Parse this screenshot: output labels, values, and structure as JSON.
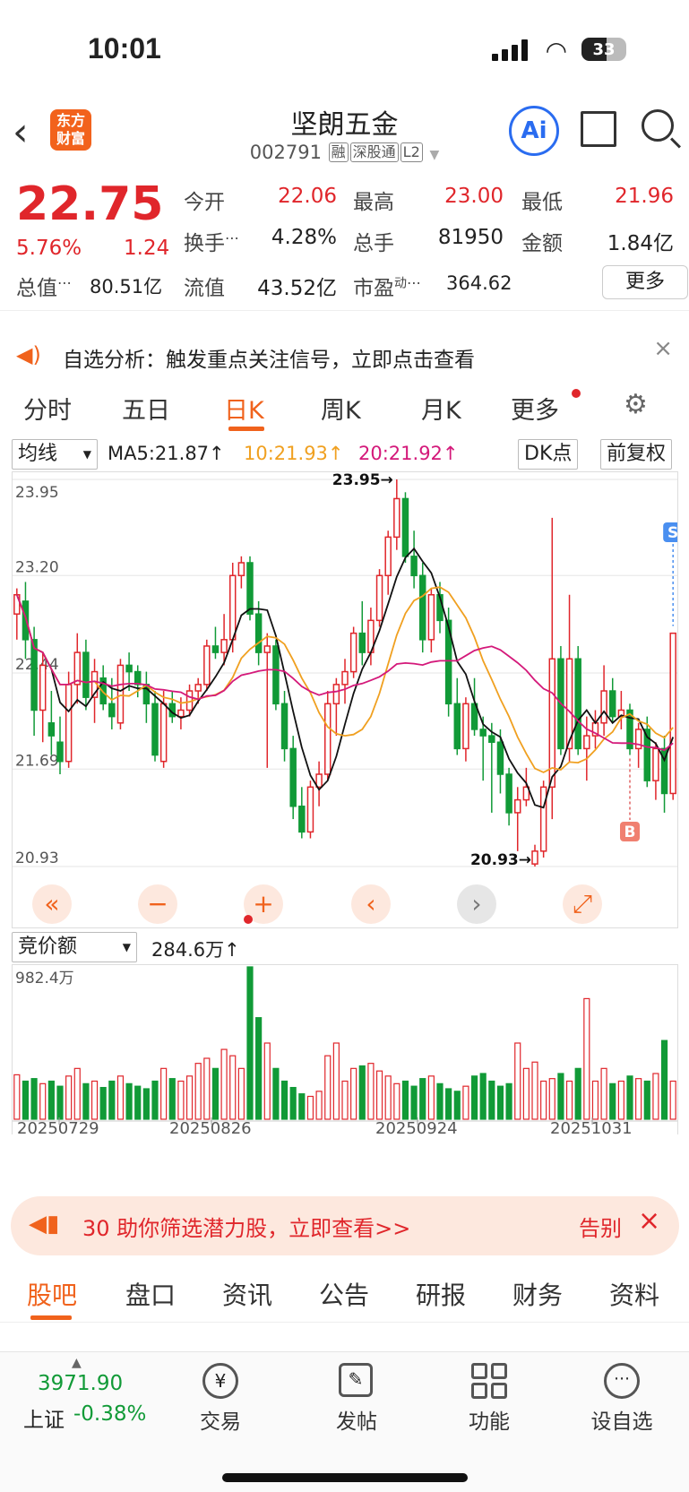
{
  "status": {
    "time": "10:01",
    "battery": "33"
  },
  "header": {
    "title": "坚朗五金",
    "code": "002791",
    "tags": [
      "融",
      "深股通",
      "L2"
    ],
    "logo_line1": "东方",
    "logo_line2": "财富",
    "ai_label": "Ai"
  },
  "quote": {
    "price": "22.75",
    "pct": "5.76%",
    "change": "1.24",
    "open_label": "今开",
    "open": "22.06",
    "high_label": "最高",
    "high": "23.00",
    "low_label": "最低",
    "low": "21.96",
    "turnover_label": "换手",
    "turnover": "4.28%",
    "volume_label": "总手",
    "volume": "81950",
    "amount_label": "金额",
    "amount": "1.84亿",
    "mcap_label": "总值",
    "mcap": "80.51亿",
    "float_label": "流值",
    "float_cap": "43.52亿",
    "pe_label": "市盈",
    "pe_sup": "动",
    "pe": "364.62",
    "more": "更多"
  },
  "notice": {
    "text": "自选分析：触发重点关注信号，立即点击查看"
  },
  "tabs": [
    "分时",
    "五日",
    "日K",
    "周K",
    "月K",
    "更多"
  ],
  "ma": {
    "selector": "均线",
    "ma5": "MA5:21.87↑",
    "ma10": "10:21.93↑",
    "ma20": "20:21.92↑",
    "dk": "DK点",
    "adjust": "前复权"
  },
  "chart_data": {
    "type": "candlestick",
    "y_labels": [
      "23.95",
      "23.20",
      "22.44",
      "21.69",
      "20.93"
    ],
    "ylim": [
      20.93,
      23.95
    ],
    "max_label": "23.95→",
    "min_label": "20.93→",
    "sell_mark": "S",
    "buy_mark": "B",
    "x_labels": [
      "20250729",
      "20250826",
      "20250924",
      "20251031"
    ],
    "ohlc": [
      [
        22.9,
        23.1,
        22.7,
        23.05
      ],
      [
        23.0,
        23.15,
        22.55,
        22.7
      ],
      [
        22.7,
        22.8,
        21.95,
        22.15
      ],
      [
        22.15,
        22.6,
        21.9,
        22.5
      ],
      [
        22.05,
        22.3,
        21.8,
        21.95
      ],
      [
        21.9,
        22.1,
        21.65,
        21.75
      ],
      [
        21.75,
        22.45,
        21.7,
        22.35
      ],
      [
        22.35,
        22.75,
        22.2,
        22.6
      ],
      [
        22.6,
        22.7,
        22.15,
        22.25
      ],
      [
        22.25,
        22.55,
        22.05,
        22.45
      ],
      [
        22.4,
        22.5,
        22.15,
        22.2
      ],
      [
        22.2,
        22.4,
        22.0,
        22.1
      ],
      [
        22.05,
        22.55,
        22.0,
        22.5
      ],
      [
        22.5,
        22.6,
        22.3,
        22.45
      ],
      [
        22.45,
        22.5,
        22.25,
        22.35
      ],
      [
        22.35,
        22.45,
        22.05,
        22.2
      ],
      [
        22.2,
        22.3,
        21.75,
        21.8
      ],
      [
        21.75,
        22.3,
        21.7,
        22.2
      ],
      [
        22.2,
        22.3,
        22.05,
        22.1
      ],
      [
        22.1,
        22.25,
        22.0,
        22.15
      ],
      [
        22.15,
        22.35,
        22.1,
        22.3
      ],
      [
        22.3,
        22.4,
        22.2,
        22.35
      ],
      [
        22.35,
        22.7,
        22.3,
        22.65
      ],
      [
        22.65,
        22.8,
        22.55,
        22.6
      ],
      [
        22.6,
        22.9,
        22.5,
        22.7
      ],
      [
        22.7,
        23.3,
        22.6,
        23.2
      ],
      [
        23.2,
        23.35,
        23.1,
        23.3
      ],
      [
        23.3,
        23.35,
        22.85,
        22.9
      ],
      [
        22.9,
        23.0,
        22.5,
        22.6
      ],
      [
        22.6,
        22.75,
        21.7,
        22.65
      ],
      [
        22.65,
        22.7,
        22.15,
        22.2
      ],
      [
        22.2,
        22.3,
        21.75,
        21.85
      ],
      [
        21.85,
        21.95,
        21.3,
        21.4
      ],
      [
        21.4,
        21.55,
        21.15,
        21.2
      ],
      [
        21.2,
        21.6,
        21.15,
        21.55
      ],
      [
        21.55,
        21.75,
        21.4,
        21.65
      ],
      [
        21.65,
        22.3,
        21.6,
        22.2
      ],
      [
        22.2,
        22.4,
        21.95,
        22.35
      ],
      [
        22.35,
        22.55,
        22.2,
        22.45
      ],
      [
        22.45,
        22.8,
        22.4,
        22.75
      ],
      [
        22.75,
        23.0,
        22.5,
        22.6
      ],
      [
        22.6,
        22.95,
        22.5,
        22.85
      ],
      [
        22.85,
        23.25,
        22.8,
        23.2
      ],
      [
        23.2,
        23.55,
        23.05,
        23.5
      ],
      [
        23.5,
        23.95,
        23.4,
        23.8
      ],
      [
        23.8,
        23.85,
        23.3,
        23.35
      ],
      [
        23.35,
        23.55,
        23.1,
        23.2
      ],
      [
        23.2,
        23.3,
        22.6,
        22.7
      ],
      [
        22.7,
        23.1,
        22.6,
        23.05
      ],
      [
        23.05,
        23.15,
        22.75,
        22.85
      ],
      [
        22.85,
        22.95,
        22.1,
        22.2
      ],
      [
        22.2,
        22.4,
        21.8,
        21.85
      ],
      [
        21.85,
        22.25,
        21.75,
        22.2
      ],
      [
        22.2,
        22.4,
        21.95,
        22.0
      ],
      [
        22.0,
        22.1,
        21.6,
        21.95
      ],
      [
        21.95,
        22.05,
        21.35,
        21.9
      ],
      [
        21.9,
        22.0,
        21.5,
        21.65
      ],
      [
        21.65,
        21.7,
        21.25,
        21.35
      ],
      [
        21.35,
        21.55,
        21.05,
        21.45
      ],
      [
        21.45,
        21.7,
        21.4,
        21.55
      ],
      [
        20.95,
        21.1,
        20.93,
        21.05
      ],
      [
        21.05,
        21.6,
        21.0,
        21.55
      ],
      [
        21.55,
        23.65,
        21.3,
        22.55
      ],
      [
        22.55,
        22.65,
        21.8,
        21.85
      ],
      [
        21.85,
        23.05,
        21.75,
        22.55
      ],
      [
        22.55,
        22.65,
        21.8,
        21.85
      ],
      [
        21.85,
        22.1,
        21.6,
        21.95
      ],
      [
        21.95,
        22.15,
        21.85,
        22.05
      ],
      [
        22.05,
        22.5,
        21.95,
        22.3
      ],
      [
        22.3,
        22.4,
        22.05,
        22.1
      ],
      [
        22.1,
        22.3,
        22.0,
        22.15
      ],
      [
        22.15,
        22.2,
        21.8,
        21.85
      ],
      [
        21.85,
        22.05,
        21.7,
        22.0
      ],
      [
        22.0,
        22.1,
        21.55,
        21.6
      ],
      [
        21.6,
        21.9,
        21.45,
        21.85
      ],
      [
        21.85,
        21.95,
        21.35,
        21.5
      ],
      [
        21.5,
        22.75,
        21.45,
        22.75
      ]
    ]
  },
  "volume": {
    "selector": "竞价额",
    "value": "284.6万↑",
    "max_label": "982.4万",
    "values": [
      35,
      30,
      32,
      28,
      30,
      26,
      34,
      40,
      28,
      30,
      25,
      30,
      34,
      28,
      26,
      24,
      30,
      40,
      32,
      30,
      34,
      44,
      48,
      40,
      55,
      50,
      40,
      120,
      80,
      60,
      40,
      30,
      25,
      20,
      18,
      22,
      50,
      60,
      30,
      40,
      42,
      44,
      38,
      34,
      28,
      30,
      26,
      32,
      34,
      28,
      24,
      22,
      26,
      34,
      36,
      30,
      26,
      28,
      60,
      40,
      45,
      30,
      32,
      36,
      30,
      40,
      95,
      30,
      40,
      28,
      30,
      34,
      32,
      30,
      36,
      62,
      30
    ]
  },
  "banner": {
    "text": "30 助你筛选潜力股，立即查看>>",
    "action": "告别"
  },
  "bottom_tabs": [
    "股吧",
    "盘口",
    "资讯",
    "公告",
    "研报",
    "财务",
    "资料"
  ],
  "footer": {
    "index_value": "3971.90",
    "index_name": "上证",
    "index_change": "-0.38%",
    "items": [
      "交易",
      "发帖",
      "功能",
      "设自选"
    ]
  }
}
